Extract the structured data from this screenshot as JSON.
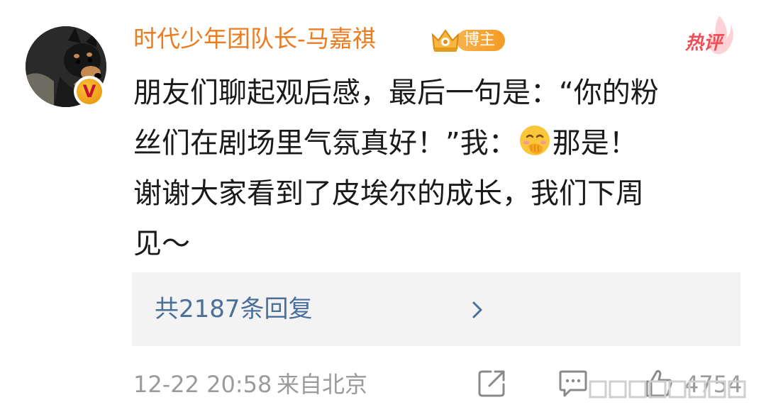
{
  "comment": {
    "username": "时代少年团队长-马嘉祺",
    "rank_badge": "博主",
    "hot_tag": "热评",
    "text_lines": [
      "朋友们聊起观后感，最后一句是：“你的粉",
      "丝们在剧场里气氛真好！”我：",
      "那是！",
      "谢谢大家看到了皮埃尔的成长，我们下周",
      "见～"
    ],
    "emoji": "covering-mouth-smile-emoji",
    "replies_label": "共2187条回复",
    "timestamp": "12-22 20:58",
    "source": "来自北京",
    "like_count": "4754"
  },
  "colors": {
    "username": "#ed7b20",
    "reply_link": "#4a6f98",
    "hot_tag": "#f04e57",
    "meta_gray": "#9b9b9b"
  }
}
